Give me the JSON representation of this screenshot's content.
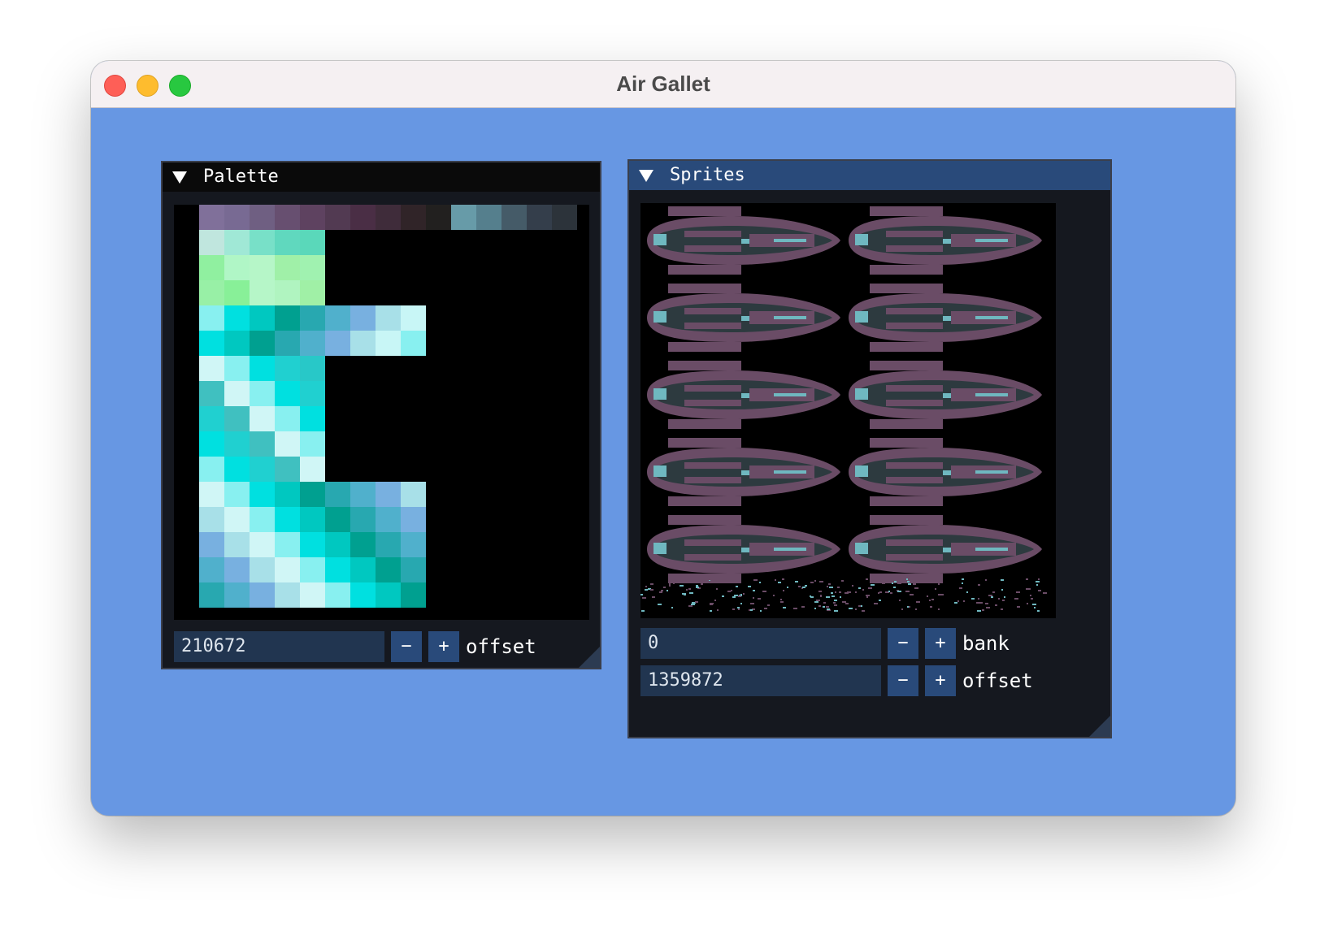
{
  "window": {
    "title": "Air Gallet"
  },
  "palette_panel": {
    "title": "Palette",
    "offset_value": "210672",
    "minus_label": "−",
    "plus_label": "+",
    "offset_label": "offset",
    "swatch_rows": [
      [
        "#80709a",
        "#786a93",
        "#6f5f82",
        "#674f70",
        "#5e4260",
        "#523a52",
        "#4a2e45",
        "#3f2c3a",
        "#302428",
        "#22201f",
        "#679ba8",
        "#557f8d",
        "#455b68",
        "#343e4b",
        "#2c333a"
      ],
      [
        "#c0e6de",
        "#a0e8d6",
        "#78e0c8",
        "#60d8be",
        "#5ad8ba"
      ],
      [
        "#90f0a0",
        "#b0f6c6",
        "#b6f6c8",
        "#a0f0a8",
        "#a0f2b0"
      ],
      [
        "#98f0a6",
        "#88f098",
        "#b6f6c8",
        "#b0f4c0",
        "#a0f0a6"
      ],
      [
        "#88f0f0",
        "#00e0e0",
        "#00c8c0",
        "#00a090",
        "#28a8b0",
        "#50b0cc",
        "#78b0e0",
        "#a8e0e8",
        "#c8f6f6"
      ],
      [
        "#00e0e0",
        "#00c8c0",
        "#00a090",
        "#28a8b0",
        "#50b0cc",
        "#78b0e0",
        "#a8e0e8",
        "#c8f6f6",
        "#88f0f0"
      ],
      [
        "#d0f6f6",
        "#88f0f0",
        "#00e0e0",
        "#20d0d0",
        "#28c8c8"
      ],
      [
        "#40c0c0",
        "#d0f6f6",
        "#88f0f0",
        "#00e0e0",
        "#20d0d0"
      ],
      [
        "#20d0d0",
        "#40c0c0",
        "#d0f6f6",
        "#88f0f0",
        "#00e0e0"
      ],
      [
        "#00e0e0",
        "#20d0d0",
        "#40c0c0",
        "#d0f6f6",
        "#88f0f0"
      ],
      [
        "#88f0f0",
        "#00e0e0",
        "#20d0d0",
        "#40c0c0",
        "#d0f6f6"
      ],
      [
        "#d0f6f6",
        "#88f0f0",
        "#00e0e0",
        "#00c8c0",
        "#00a090",
        "#28a8b0",
        "#50b0cc",
        "#78b0e0",
        "#a8e0e8"
      ],
      [
        "#a8e0e8",
        "#d0f6f6",
        "#88f0f0",
        "#00e0e0",
        "#00c8c0",
        "#00a090",
        "#28a8b0",
        "#50b0cc",
        "#78b0e0"
      ],
      [
        "#78b0e0",
        "#a8e0e8",
        "#d0f6f6",
        "#88f0f0",
        "#00e0e0",
        "#00c8c0",
        "#00a090",
        "#28a8b0",
        "#50b0cc"
      ],
      [
        "#50b0cc",
        "#78b0e0",
        "#a8e0e8",
        "#d0f6f6",
        "#88f0f0",
        "#00e0e0",
        "#00c8c0",
        "#00a090",
        "#28a8b0"
      ],
      [
        "#28a8b0",
        "#50b0cc",
        "#78b0e0",
        "#a8e0e8",
        "#d0f6f6",
        "#88f0f0",
        "#00e0e0",
        "#00c8c0",
        "#00a090"
      ]
    ]
  },
  "sprites_panel": {
    "title": "Sprites",
    "bank_value": "0",
    "bank_label": "bank",
    "offset_value": "1359872",
    "offset_label": "offset",
    "minus_label": "−",
    "plus_label": "+",
    "sprite_grid": {
      "columns": 2,
      "rows": 5,
      "sprite_icon": "spaceship-sprite-icon"
    }
  },
  "colors": {
    "desktop": "#6797e3",
    "panel_bg": "#15181f",
    "header_active": "#294a7a",
    "field": "#213550",
    "button": "#294a7a",
    "ship_hull": "#6a4c66",
    "ship_shadow": "#2d3a3f",
    "ship_accent": "#6fb8c0"
  }
}
